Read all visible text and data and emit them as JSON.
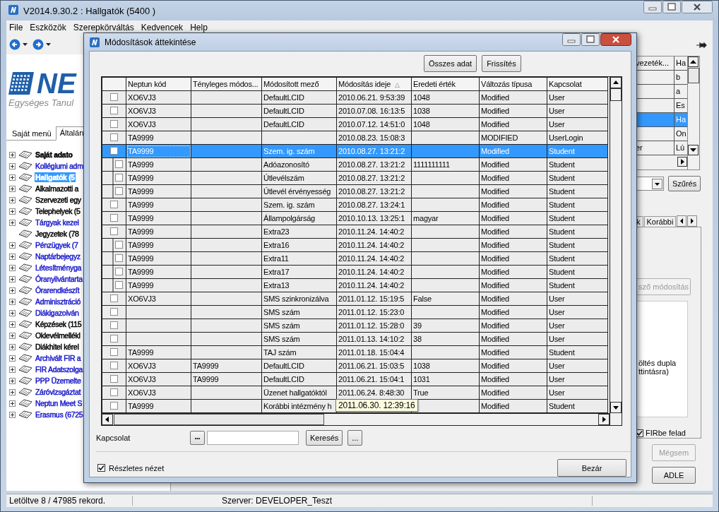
{
  "window": {
    "title": "V2014.9.30.2 : Hallgatók (5400  )"
  },
  "menu": [
    "File",
    "Eszközök",
    "Szerepkörváltás",
    "Kedvencek",
    "Help"
  ],
  "logo": {
    "wordmark": "NE",
    "tagline": "Egységes Tanul"
  },
  "side_tabs": [
    {
      "label": "Saját menü",
      "selected": false
    },
    {
      "label": "Általán",
      "selected": true
    }
  ],
  "tree": [
    {
      "label": "Saját adato",
      "color": "#000000",
      "bold": true,
      "selected": false,
      "expandable": true
    },
    {
      "label": "Kollégiumi adm",
      "color": "#1c1ccc",
      "bold": false,
      "selected": false,
      "expandable": true
    },
    {
      "label": "Hallgatók (5",
      "bold": true,
      "selected": true,
      "expandable": true
    },
    {
      "label": "Alkalmazotti a",
      "color": "#000000",
      "bold": false,
      "selected": false,
      "expandable": true
    },
    {
      "label": "Szervezeti egy",
      "color": "#000000",
      "bold": false,
      "selected": false,
      "expandable": true
    },
    {
      "label": "Telephelyek (5",
      "color": "#000000",
      "bold": false,
      "selected": false,
      "expandable": true
    },
    {
      "label": "Tárgyak kezel",
      "color": "#1c1ccc",
      "bold": false,
      "selected": false,
      "expandable": true
    },
    {
      "label": "Jegyzetek (78",
      "color": "#000000",
      "bold": false,
      "selected": false,
      "expandable": false
    },
    {
      "label": "Pénzügyek (7",
      "color": "#1c1ccc",
      "bold": false,
      "selected": false,
      "expandable": true
    },
    {
      "label": "Naptárbejegyz",
      "color": "#1c1ccc",
      "bold": false,
      "selected": false,
      "expandable": true
    },
    {
      "label": "Létesítményga",
      "color": "#1c1ccc",
      "bold": false,
      "selected": false,
      "expandable": true
    },
    {
      "label": "Óranyilvántarta",
      "color": "#1c1ccc",
      "bold": false,
      "selected": false,
      "expandable": true
    },
    {
      "label": "Órarendkészít",
      "color": "#1c1ccc",
      "bold": false,
      "selected": false,
      "expandable": true
    },
    {
      "label": "Adminisztráció",
      "color": "#1c1ccc",
      "bold": false,
      "selected": false,
      "expandable": true
    },
    {
      "label": "Diákigazolván",
      "color": "#1c1ccc",
      "bold": false,
      "selected": false,
      "expandable": true
    },
    {
      "label": "Képzések (115",
      "color": "#000000",
      "bold": false,
      "selected": false,
      "expandable": true
    },
    {
      "label": "Oklevélmellékl",
      "color": "#000000",
      "bold": false,
      "selected": false,
      "expandable": true
    },
    {
      "label": "Diákhitel kérel",
      "color": "#000000",
      "bold": false,
      "selected": false,
      "expandable": true
    },
    {
      "label": "Archivált FIR a",
      "color": "#1c1ccc",
      "bold": false,
      "selected": false,
      "expandable": true
    },
    {
      "label": "FIR Adatszolga",
      "color": "#1c1ccc",
      "bold": false,
      "selected": false,
      "expandable": true
    },
    {
      "label": "PPP Üzemelte",
      "color": "#1c1ccc",
      "bold": false,
      "selected": false,
      "expandable": true
    },
    {
      "label": "Záróvizsgáztat",
      "color": "#1c1ccc",
      "bold": false,
      "selected": false,
      "expandable": true
    },
    {
      "label": "Neptun Meet S",
      "color": "#1c1ccc",
      "bold": false,
      "selected": false,
      "expandable": true
    },
    {
      "label": "Erasmus (6725",
      "color": "#1c1ccc",
      "bold": false,
      "selected": false,
      "expandable": true
    }
  ],
  "right_panel": {
    "grid": {
      "columns": [
        "vezeték...",
        "Ha"
      ],
      "rows": [
        {
          "selected": false,
          "cells": {
            "column_2": "b"
          }
        },
        {
          "selected": false,
          "cells": {
            "column_2": "a"
          }
        },
        {
          "selected": false,
          "cells": {
            "column_2": "Es"
          }
        },
        {
          "selected": true,
          "cells": {
            "column_2": "Ha"
          }
        },
        {
          "selected": false,
          "cells": {
            "column_2": "On"
          }
        },
        {
          "selected": false,
          "cells": {
            "column_1": "er",
            "column_2": "Lú"
          }
        }
      ]
    },
    "filter_button": "Szűrés",
    "tabs": [
      "k",
      "Korábbi"
    ],
    "modify_button": {
      "label": "sző módosítás",
      "disabled": true
    },
    "note_lines": [
      "öltés dupla",
      "ttintásra)"
    ],
    "fir_checkbox": {
      "label": "FIRbe felad",
      "checked": true
    },
    "cancel_button": {
      "label": "Mégsem",
      "disabled": true
    },
    "adle_button": {
      "label": "ADLE",
      "disabled": false
    }
  },
  "status_bar": [
    "Letöltve 8 / 47985 rekord.",
    "Szerver: DEVELOPER_Teszt"
  ],
  "dialog": {
    "title": "Módosítások áttekintése",
    "top_buttons": [
      "Összes adat",
      "Frissítés"
    ],
    "columns": [
      {
        "label": "Neptun kód"
      },
      {
        "label": "Tényleges módos..."
      },
      {
        "label": "Módosított mező"
      },
      {
        "label": "Módosítás ideje",
        "sort_mark": "△"
      },
      {
        "label": "Eredeti érték"
      },
      {
        "label": "Változás típusa"
      },
      {
        "label": "Kapcsolat"
      }
    ],
    "rows": [
      {
        "checked": false,
        "selected": false,
        "cells": {
          "neptun_kod": "XO6VJ3",
          "mezo": "DefaultLCID",
          "ido": "2010.06.21. 9:53:39",
          "eredeti": "1048",
          "tipus": "Modified",
          "kapcsolat": "User"
        }
      },
      {
        "checked": false,
        "selected": false,
        "cells": {
          "neptun_kod": "XO6VJ3",
          "mezo": "DefaultLCID",
          "ido": "2010.07.08. 16:13:5",
          "eredeti": "1038",
          "tipus": "Modified",
          "kapcsolat": "User"
        }
      },
      {
        "checked": false,
        "selected": false,
        "cells": {
          "neptun_kod": "XO6VJ3",
          "mezo": "DefaultLCID",
          "ido": "2010.07.12. 14:51:0",
          "eredeti": "1048",
          "tipus": "Modified",
          "kapcsolat": "User"
        }
      },
      {
        "checked": false,
        "selected": false,
        "cells": {
          "neptun_kod": "TA9999",
          "ido": "2010.08.23. 15:08:3",
          "tipus": "MODIFIED",
          "kapcsolat": "UserLogin"
        }
      },
      {
        "checked": false,
        "selected": true,
        "cells": {
          "neptun_kod": "TA9999",
          "mezo": "Szem. ig. szám",
          "ido": "2010.08.27. 13:21:2",
          "tipus": "Modified",
          "kapcsolat": "Student"
        },
        "children": [
          {
            "checked": false,
            "selected": false,
            "cells": {
              "neptun_kod": "TA9999",
              "mezo": "Adóazonosító",
              "ido": "2010.08.27. 13:21:2",
              "eredeti": "1111111111",
              "tipus": "Modified",
              "kapcsolat": "Student"
            }
          },
          {
            "checked": false,
            "selected": false,
            "cells": {
              "neptun_kod": "TA9999",
              "mezo": "Útlevélszám",
              "ido": "2010.08.27. 13:21:2",
              "tipus": "Modified",
              "kapcsolat": "Student"
            }
          },
          {
            "checked": false,
            "selected": false,
            "cells": {
              "neptun_kod": "TA9999",
              "mezo": "Útlevél érvényesség",
              "ido": "2010.08.27. 13:21:2",
              "tipus": "Modified",
              "kapcsolat": "Student"
            }
          }
        ]
      },
      {
        "checked": false,
        "selected": false,
        "cells": {
          "neptun_kod": "TA9999",
          "mezo": "Szem. ig. szám",
          "ido": "2010.08.27. 13:24:1",
          "tipus": "Modified",
          "kapcsolat": "Student"
        }
      },
      {
        "checked": false,
        "selected": false,
        "cells": {
          "neptun_kod": "TA9999",
          "mezo": "Állampolgárság",
          "ido": "2010.10.13. 13:25:1",
          "eredeti": "magyar",
          "tipus": "Modified",
          "kapcsolat": "Student"
        }
      },
      {
        "checked": false,
        "selected": false,
        "cells": {
          "neptun_kod": "TA9999",
          "mezo": "Extra23",
          "ido": "2010.11.24. 14:40:2",
          "tipus": "Modified",
          "kapcsolat": "Student"
        },
        "children": [
          {
            "checked": false,
            "selected": false,
            "cells": {
              "neptun_kod": "TA9999",
              "mezo": "Extra16",
              "ido": "2010.11.24. 14:40:2",
              "tipus": "Modified",
              "kapcsolat": "Student"
            }
          },
          {
            "checked": false,
            "selected": false,
            "cells": {
              "neptun_kod": "TA9999",
              "mezo": "Extra11",
              "ido": "2010.11.24. 14:40:2",
              "tipus": "Modified",
              "kapcsolat": "Student"
            }
          },
          {
            "checked": false,
            "selected": false,
            "cells": {
              "neptun_kod": "TA9999",
              "mezo": "Extra17",
              "ido": "2010.11.24. 14:40:2",
              "tipus": "Modified",
              "kapcsolat": "Student"
            }
          },
          {
            "checked": false,
            "selected": false,
            "cells": {
              "neptun_kod": "TA9999",
              "mezo": "Extra13",
              "ido": "2010.11.24. 14:40:2",
              "tipus": "Modified",
              "kapcsolat": "Student"
            }
          }
        ]
      },
      {
        "checked": false,
        "selected": false,
        "cells": {
          "neptun_kod": "XO6VJ3",
          "mezo": "SMS szinkronizálva",
          "ido": "2011.01.12. 15:19:5",
          "eredeti": "False",
          "tipus": "Modified",
          "kapcsolat": "User"
        }
      },
      {
        "checked": false,
        "selected": false,
        "cells": {
          "mezo": "SMS szám",
          "ido": "2011.01.12. 15:23:0",
          "tipus": "Modified",
          "kapcsolat": "User"
        }
      },
      {
        "checked": false,
        "selected": false,
        "cells": {
          "mezo": "SMS szám",
          "ido": "2011.01.12. 15:28:0",
          "eredeti": "39",
          "tipus": "Modified",
          "kapcsolat": "User"
        }
      },
      {
        "checked": false,
        "selected": false,
        "cells": {
          "mezo": "SMS szám",
          "ido": "2011.01.13. 14:10:2",
          "eredeti": "38",
          "tipus": "Modified",
          "kapcsolat": "User"
        }
      },
      {
        "checked": false,
        "selected": false,
        "cells": {
          "neptun_kod": "TA9999",
          "mezo": "TAJ szám",
          "ido": "2011.01.18. 15:04:4",
          "tipus": "Modified",
          "kapcsolat": "Student"
        }
      },
      {
        "checked": false,
        "selected": false,
        "cells": {
          "neptun_kod": "XO6VJ3",
          "tenyleges": "TA9999",
          "mezo": "DefaultLCID",
          "ido": "2011.06.21. 15:03:5",
          "eredeti": "1038",
          "tipus": "Modified",
          "kapcsolat": "User"
        }
      },
      {
        "checked": false,
        "selected": false,
        "cells": {
          "neptun_kod": "XO6VJ3",
          "tenyleges": "TA9999",
          "mezo": "DefaultLCID",
          "ido": "2011.06.21. 15:04:1",
          "eredeti": "1031",
          "tipus": "Modified",
          "kapcsolat": "User"
        }
      },
      {
        "checked": false,
        "selected": false,
        "cells": {
          "neptun_kod": "XO6VJ3",
          "mezo": "Üzenet hallgatóktól",
          "ido": "2011.06.24. 8:48:30",
          "eredeti": "True",
          "tipus": "Modified",
          "kapcsolat": "User"
        }
      },
      {
        "checked": false,
        "selected": false,
        "cells": {
          "neptun_kod": "TA9999",
          "mezo": "Korábbi intézmény h",
          "tipus": "Modified",
          "kapcsolat": "Student"
        },
        "tooltip": "2011.06.30. 12:39:16"
      }
    ],
    "search": {
      "label": "Kapcsolat",
      "picker_button": "•••",
      "search_button": "Keresés",
      "more_button": "..."
    },
    "detail_checkbox": {
      "label": "Részletes nézet",
      "checked": true
    },
    "close_button": "Bezár"
  }
}
